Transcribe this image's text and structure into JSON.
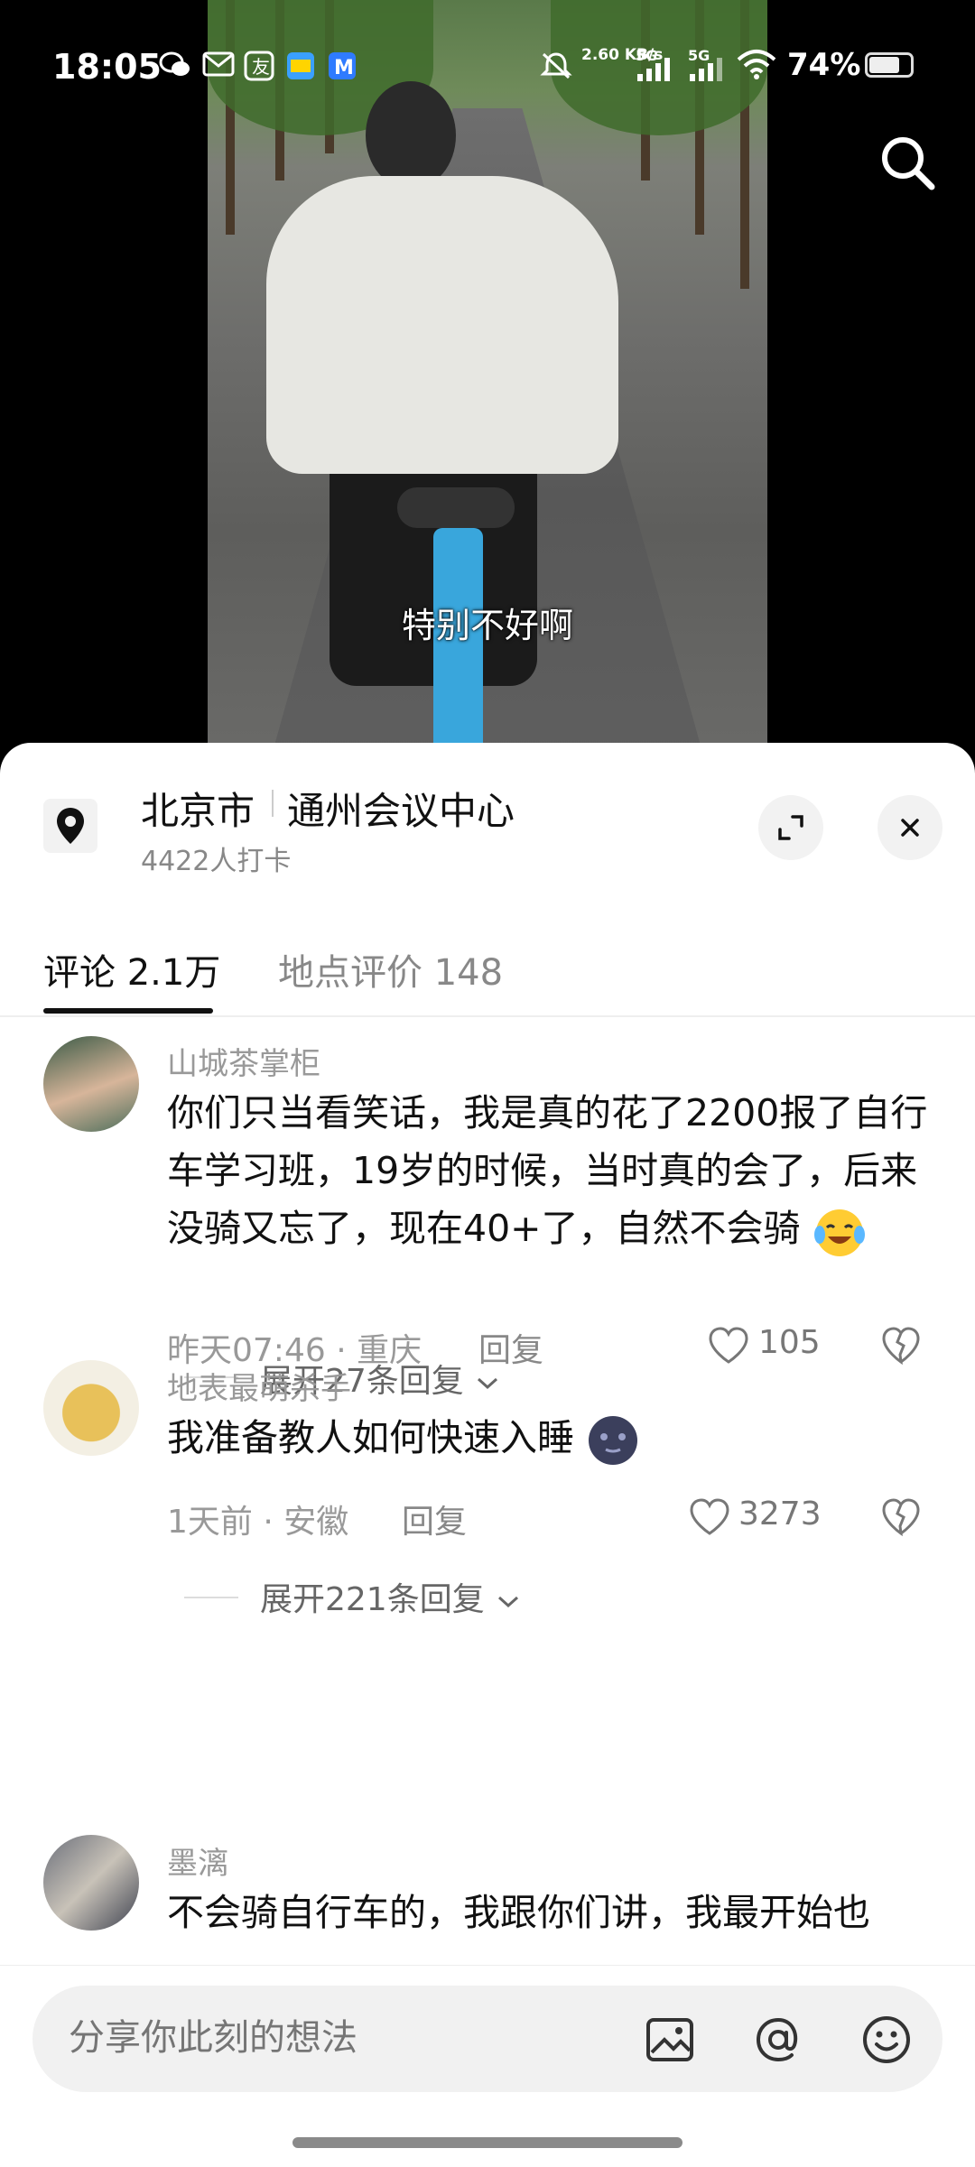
{
  "status_bar": {
    "time": "18:05",
    "net_speed": "2.60 KB/s",
    "signal_1": "5G",
    "signal_2": "5G",
    "battery": "74%",
    "battery_level": 0.74,
    "notification_icons": [
      "wechat-icon",
      "mail-icon",
      "app-icon",
      "app-icon",
      "app-icon"
    ]
  },
  "video": {
    "subtitle": "特别不好啊"
  },
  "location": {
    "city": "北京市",
    "place": "通州会议中心",
    "checkins": "4422人打卡"
  },
  "tabs": [
    {
      "label": "评论 2.1万"
    },
    {
      "label": "地点评价 148"
    }
  ],
  "comments": [
    {
      "username": "山城茶掌柜",
      "content": "你们只当看笑话，我是真的花了2200报了自行车学习班，19岁的时候，当时真的会了，后来没骑又忘了，现在40+了，自然不会骑",
      "time": "昨天07:46",
      "region": "重庆",
      "reply": "回复",
      "likes": "105",
      "expand": "展开27条回复"
    },
    {
      "username": "地表最萌杀手",
      "content": "我准备教人如何快速入睡",
      "time": "1天前",
      "region": "安徽",
      "reply": "回复",
      "likes": "3273",
      "expand": "展开221条回复"
    },
    {
      "username": "墨漓",
      "content": "不会骑自行车的，我跟你们讲，我最开始也"
    }
  ],
  "input": {
    "placeholder": "分享你此刻的想法"
  }
}
